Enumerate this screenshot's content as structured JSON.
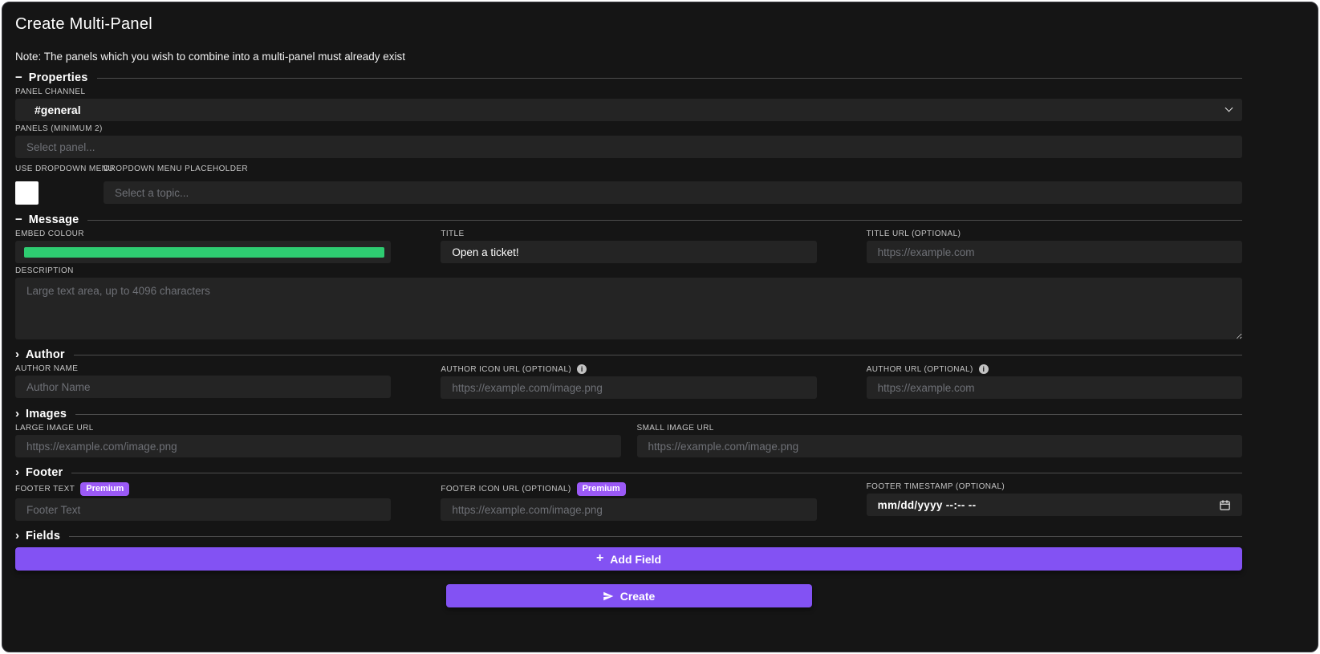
{
  "page": {
    "title": "Create Multi-Panel",
    "note": "Note: The panels which you wish to combine into a multi-panel must already exist"
  },
  "colors": {
    "accent": "#8352f3",
    "badge": "#9b59f6",
    "embed_colour": "#2ecc71"
  },
  "sections": {
    "properties": {
      "label": "Properties",
      "icon": "−"
    },
    "message": {
      "label": "Message",
      "icon": "−"
    },
    "author": {
      "label": "Author",
      "icon": "›"
    },
    "images": {
      "label": "Images",
      "icon": "›"
    },
    "footer": {
      "label": "Footer",
      "icon": "›"
    },
    "fields": {
      "label": "Fields",
      "icon": "›"
    }
  },
  "fields": {
    "panel_channel": {
      "label": "PANEL CHANNEL",
      "value": "#general"
    },
    "panels": {
      "label": "PANELS (MINIMUM 2)",
      "placeholder": "Select panel..."
    },
    "use_dropdown": {
      "label": "USE DROPDOWN MENU"
    },
    "dropdown_placeholder": {
      "label": "DROPDOWN MENU PLACEHOLDER",
      "placeholder": "Select a topic..."
    },
    "embed_colour": {
      "label": "EMBED COLOUR"
    },
    "title": {
      "label": "TITLE",
      "value": "Open a ticket!"
    },
    "title_url": {
      "label": "TITLE URL (OPTIONAL)",
      "placeholder": "https://example.com"
    },
    "description": {
      "label": "DESCRIPTION",
      "placeholder": "Large text area, up to 4096 characters"
    },
    "author_name": {
      "label": "AUTHOR NAME",
      "placeholder": "Author Name"
    },
    "author_icon_url": {
      "label": "AUTHOR ICON URL (OPTIONAL)",
      "placeholder": "https://example.com/image.png",
      "info": "i"
    },
    "author_url": {
      "label": "AUTHOR URL (OPTIONAL)",
      "placeholder": "https://example.com",
      "info": "i"
    },
    "large_image_url": {
      "label": "LARGE IMAGE URL",
      "placeholder": "https://example.com/image.png"
    },
    "small_image_url": {
      "label": "SMALL IMAGE URL",
      "placeholder": "https://example.com/image.png"
    },
    "footer_text": {
      "label": "FOOTER TEXT",
      "badge": "Premium",
      "placeholder": "Footer Text"
    },
    "footer_icon_url": {
      "label": "FOOTER ICON URL (OPTIONAL)",
      "badge": "Premium",
      "placeholder": "https://example.com/image.png"
    },
    "footer_timestamp": {
      "label": "FOOTER TIMESTAMP (OPTIONAL)",
      "value": "mm/dd/yyyy --:-- --"
    }
  },
  "buttons": {
    "add_field": {
      "icon": "+",
      "label": "Add Field"
    },
    "create": {
      "label": "Create"
    }
  }
}
